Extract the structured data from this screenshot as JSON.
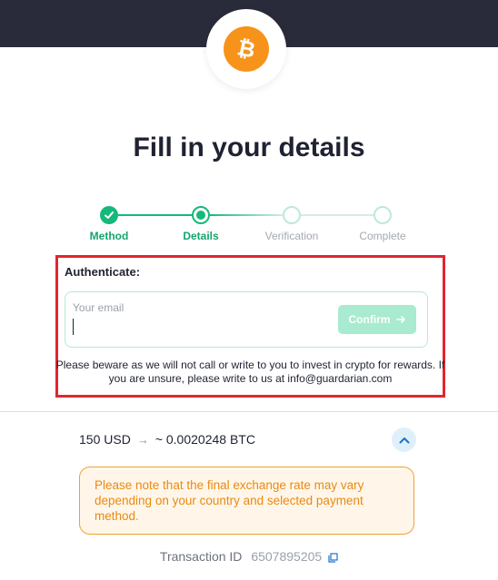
{
  "header": {
    "logo_icon": "bitcoin-icon",
    "logo_color": "#f7931a",
    "bar_color": "#2a2b3a"
  },
  "page": {
    "title": "Fill in your details"
  },
  "stepper": {
    "steps": [
      {
        "label": "Method",
        "state": "done"
      },
      {
        "label": "Details",
        "state": "active"
      },
      {
        "label": "Verification",
        "state": "pending"
      },
      {
        "label": "Complete",
        "state": "pending"
      }
    ],
    "accent": "#15b97a"
  },
  "auth": {
    "label": "Authenticate:",
    "email_placeholder": "Your email",
    "email_value": "",
    "confirm_label": "Confirm",
    "notice": "Please beware as we will not call or write to you to invest in crypto for rewards. If you are unsure, please write to us at info@guardarian.com"
  },
  "summary": {
    "from_amount": "150 USD",
    "to_amount": "~ 0.0020248 BTC",
    "warning": "Please note that the final exchange rate may vary depending on your country and selected payment method.",
    "transaction_label": "Transaction ID",
    "transaction_id": "6507895205"
  }
}
